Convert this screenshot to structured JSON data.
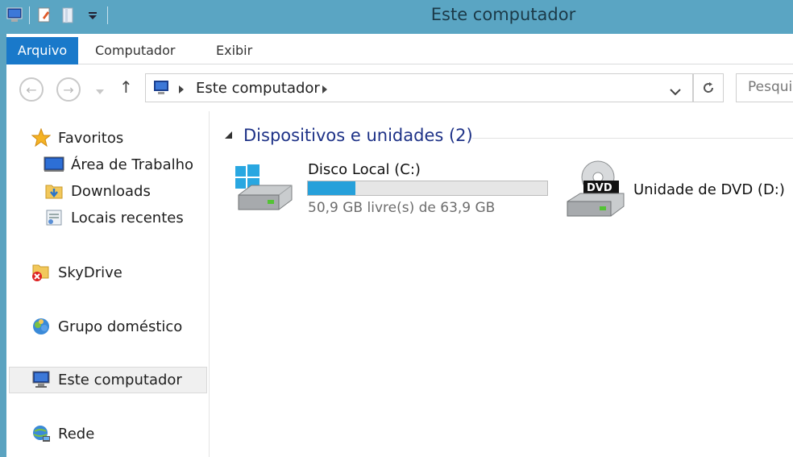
{
  "window": {
    "title": "Este computador",
    "qat_icons": [
      "computer-icon",
      "properties-icon",
      "new-folder-icon",
      "customize-qat-icon"
    ]
  },
  "ribbon": {
    "tabs": [
      "Arquivo",
      "Computador",
      "Exibir"
    ],
    "accent": "#1979ca"
  },
  "address_bar": {
    "path": "Este computador",
    "search_placeholder": "Pesquis"
  },
  "nav_pane": {
    "favorites": {
      "label": "Favoritos",
      "items": [
        "Área de Trabalho",
        "Downloads",
        "Locais recentes"
      ]
    },
    "skydrive": "SkyDrive",
    "homegroup": "Grupo doméstico",
    "this_pc": "Este computador",
    "network": "Rede",
    "selected": "Este computador"
  },
  "content": {
    "group_title": "Dispositivos e unidades (2)",
    "drives": [
      {
        "name": "Disco Local (C:)",
        "free_text": "50,9 GB livre(s) de 63,9 GB",
        "used_fraction": 0.2,
        "bar_color": "#26a0da"
      },
      {
        "name": "Unidade de DVD (D:)",
        "badge": "DVD"
      }
    ]
  }
}
